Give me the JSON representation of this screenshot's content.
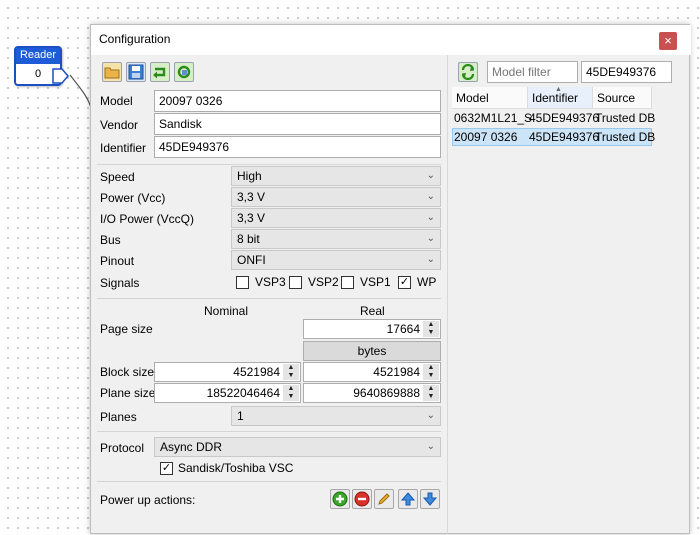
{
  "reader": {
    "title": "Reader",
    "value": "0"
  },
  "window": {
    "title": "Configuration",
    "close_glyph": "×"
  },
  "toolbar": {
    "icons": [
      "open-folder-icon",
      "save-icon",
      "load-icon",
      "refresh-icon"
    ]
  },
  "identity": {
    "model_label": "Model",
    "model_value": "20097 0326",
    "vendor_label": "Vendor",
    "vendor_value": "Sandisk",
    "identifier_label": "Identifier",
    "identifier_value": "45DE949376"
  },
  "settings": {
    "speed_label": "Speed",
    "speed_value": "High",
    "power_label": "Power (Vcc)",
    "power_value": "3,3 V",
    "io_power_label": "I/O Power (VccQ)",
    "io_power_value": "3,3 V",
    "bus_label": "Bus",
    "bus_value": "8 bit",
    "pinout_label": "Pinout",
    "pinout_value": "ONFI",
    "signals_label": "Signals",
    "signals": [
      {
        "label": "VSP3",
        "checked": false
      },
      {
        "label": "VSP2",
        "checked": false
      },
      {
        "label": "VSP1",
        "checked": false
      },
      {
        "label": "WP",
        "checked": true
      }
    ]
  },
  "geometry": {
    "nominal_header": "Nominal",
    "real_header": "Real",
    "page_size_label": "Page size",
    "page_size_real": "17664",
    "unit_button": "bytes",
    "block_size_label": "Block size",
    "block_size_nominal": "4521984",
    "block_size_real": "4521984",
    "plane_size_label": "Plane size",
    "plane_size_nominal": "18522046464",
    "plane_size_real": "9640869888",
    "planes_label": "Planes",
    "planes_value": "1"
  },
  "protocol": {
    "label": "Protocol",
    "value": "Async DDR",
    "vsc_label": "Sandisk/Toshiba VSC",
    "vsc_checked": true
  },
  "power_up": {
    "label": "Power up actions:",
    "icons": [
      "add-icon",
      "remove-icon",
      "edit-icon",
      "move-up-icon",
      "move-down-icon"
    ]
  },
  "database": {
    "filter_placeholder": "Model filter",
    "id_filter_value": "45DE949376",
    "columns": [
      "Model",
      "Identifier",
      "Source"
    ],
    "rows": [
      {
        "model": "0632M1L21_S",
        "identifier": "45DE949376",
        "source": "Trusted DB",
        "selected": false
      },
      {
        "model": "20097 0326",
        "identifier": "45DE949376",
        "source": "Trusted DB",
        "selected": true
      }
    ]
  },
  "colors": {
    "accent": "#1e5bd8",
    "close": "#c85050",
    "selection": "#cce4f7"
  }
}
